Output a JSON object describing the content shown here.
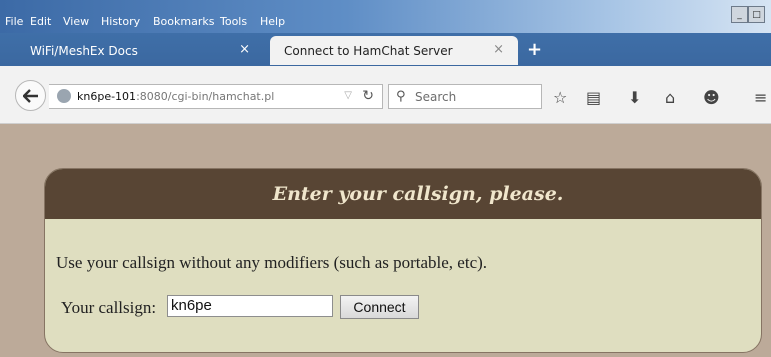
{
  "menu": [
    {
      "label": "File"
    },
    {
      "label": "Edit"
    },
    {
      "label": "View"
    },
    {
      "label": "History"
    },
    {
      "label": "Bookmarks"
    },
    {
      "label": "Tools"
    },
    {
      "label": "Help"
    }
  ],
  "window_buttons": {
    "minimize": "_",
    "maximize": "□"
  },
  "tabs": [
    {
      "title": "WiFi/MeshEx Docs",
      "close": "×"
    },
    {
      "title": "Connect to HamChat Server",
      "close": "×"
    }
  ],
  "new_tab": "+",
  "nav": {
    "url_host": "kn6pe-101",
    "url_rest": ":8080/cgi-bin/hamchat.pl",
    "search_placeholder": "Search"
  },
  "icons": {
    "back": "back-arrow-icon",
    "globe": "globe-icon",
    "dropdown": "dropdown-arrow-icon",
    "reload": "reload-icon",
    "search": "search-icon",
    "bookmark": "star-icon",
    "reading": "reading-list-icon",
    "download": "download-icon",
    "home": "home-icon",
    "chat": "chat-icon",
    "menu": "hamburger-menu-icon"
  },
  "page": {
    "title": "Enter your callsign, please.",
    "instructions": "Use your callsign without any modifiers (such as portable, etc).",
    "callsign_label": "Your callsign:",
    "callsign_value": "kn6pe",
    "connect_label": "Connect"
  },
  "colors": {
    "panel_header": "#584534",
    "panel_body": "#dfdec0",
    "page_bg": "#bcaa99",
    "title_text": "#f0e6cc"
  }
}
